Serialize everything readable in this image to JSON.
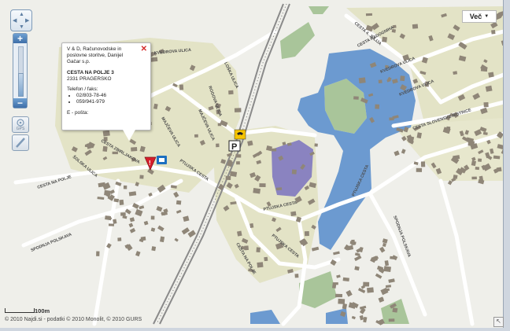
{
  "controls": {
    "more_button": "Več"
  },
  "popup": {
    "name": "V & D, Računovodske in poslovne storitve, Danijel Gačar s.p.",
    "address": "CESTA NA POLJE 3",
    "city": "2331 PRAGERSKO",
    "phone_label": "Telefon / faks:",
    "phones": [
      "02/803-78-46",
      "059/941-979"
    ],
    "email_label": "E - pošta:"
  },
  "streets": {
    "s1": "KVEDROVA ULICA",
    "s2": "MAJČEVA ULICA",
    "s3": "ROGOVA ULICA",
    "s4": "CESTA NA POLJE",
    "s5": "PTUJSKA CESTA",
    "s6": "PTUJSKA CESTA",
    "s7": "PTUJSKA CESTA",
    "s8": "PTUJSKA CESTA",
    "s9": "SPODNJA POLSKAVA",
    "s10": "SPODNJA POLSKAVA",
    "s11": "ŠOLSKA ULICA",
    "s12": "KVEDROVA ULICA",
    "s13": "KVEDROVA ULICA",
    "s14": "CESTA SLOVENSKE BISTRICE",
    "s15": "CESTA 4. JULIJA",
    "s16": "CESTA RADOGNIHA",
    "s17": "CESTA ZBIRLJAKOVA",
    "s18": "LOŠKA ULICA",
    "s19": "CESTA NA POLJE",
    "s20": "MAJČEVA ULICA"
  },
  "scale": "100m",
  "copyright": "© 2010 Najdi.si - podatki © 2010 Monolit, © 2010 GURS",
  "colors": {
    "water": "#6c9ad0",
    "land": "#efefea",
    "urban": "#e4e4c8",
    "building": "#8f8678",
    "industrial": "#8a83c0",
    "green": "#a9c59a",
    "road": "#ffffff",
    "rail": "#888888",
    "pin": "#d61e2b"
  }
}
